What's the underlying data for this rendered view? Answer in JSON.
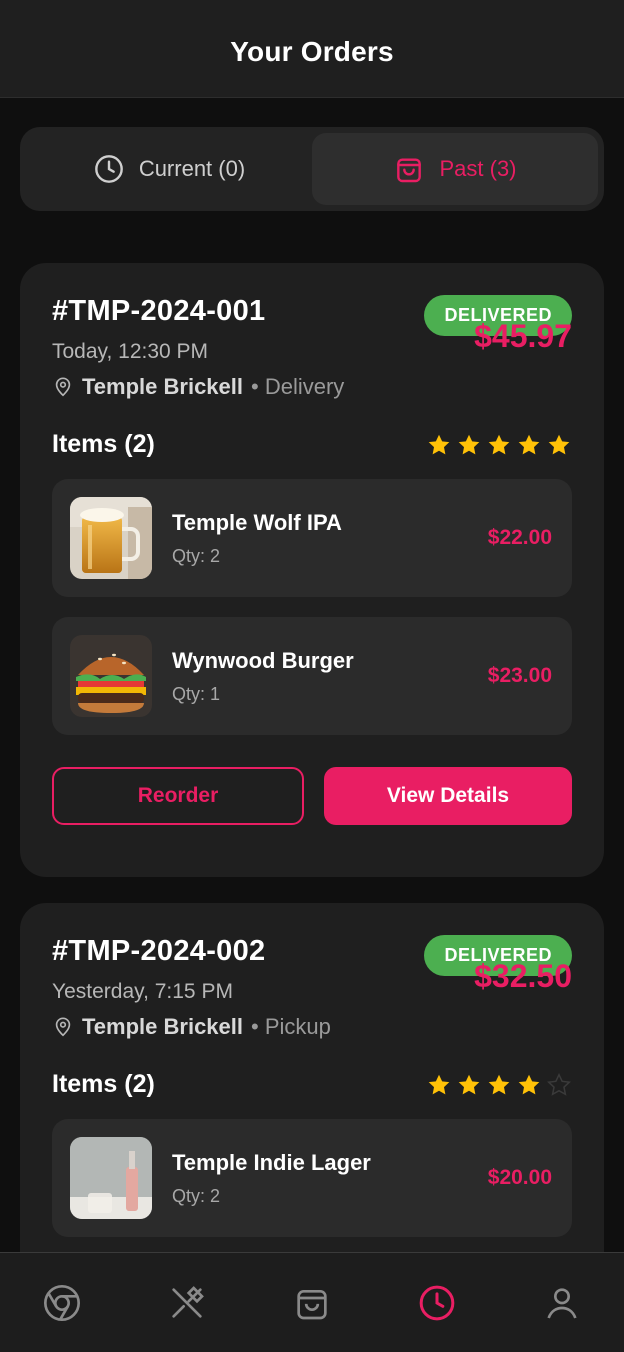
{
  "header": {
    "title": "Your Orders"
  },
  "tabs": [
    {
      "label": "Current (0)",
      "icon": "clock-icon",
      "active": false
    },
    {
      "label": "Past (3)",
      "icon": "bag-icon",
      "active": true
    }
  ],
  "orders": [
    {
      "id": "#TMP-2024-001",
      "time": "Today, 12:30 PM",
      "status": "DELIVERED",
      "total": "$45.97",
      "store": "Temple Brickell",
      "mode": "• Delivery",
      "items_title": "Items (2)",
      "rating": 5,
      "items": [
        {
          "name": "Temple Wolf IPA",
          "qty": "Qty: 2",
          "price": "$22.00",
          "thumb": "beer-mug"
        },
        {
          "name": "Wynwood Burger",
          "qty": "Qty: 1",
          "price": "$23.00",
          "thumb": "burger"
        }
      ],
      "reorder_label": "Reorder",
      "details_label": "View Details"
    },
    {
      "id": "#TMP-2024-002",
      "time": "Yesterday, 7:15 PM",
      "status": "DELIVERED",
      "total": "$32.50",
      "store": "Temple Brickell",
      "mode": "• Pickup",
      "items_title": "Items (2)",
      "rating": 4,
      "items": [
        {
          "name": "Temple Indie Lager",
          "qty": "Qty: 2",
          "price": "$20.00",
          "thumb": "lager-glass"
        }
      ]
    }
  ],
  "colors": {
    "accent": "#e91e63",
    "success": "#4caf50",
    "star": "#ffc107"
  },
  "nav": [
    {
      "icon": "chrome-icon",
      "active": false
    },
    {
      "icon": "utensils-icon",
      "active": false
    },
    {
      "icon": "bag-icon",
      "active": false
    },
    {
      "icon": "clock-icon",
      "active": true
    },
    {
      "icon": "user-icon",
      "active": false
    }
  ]
}
